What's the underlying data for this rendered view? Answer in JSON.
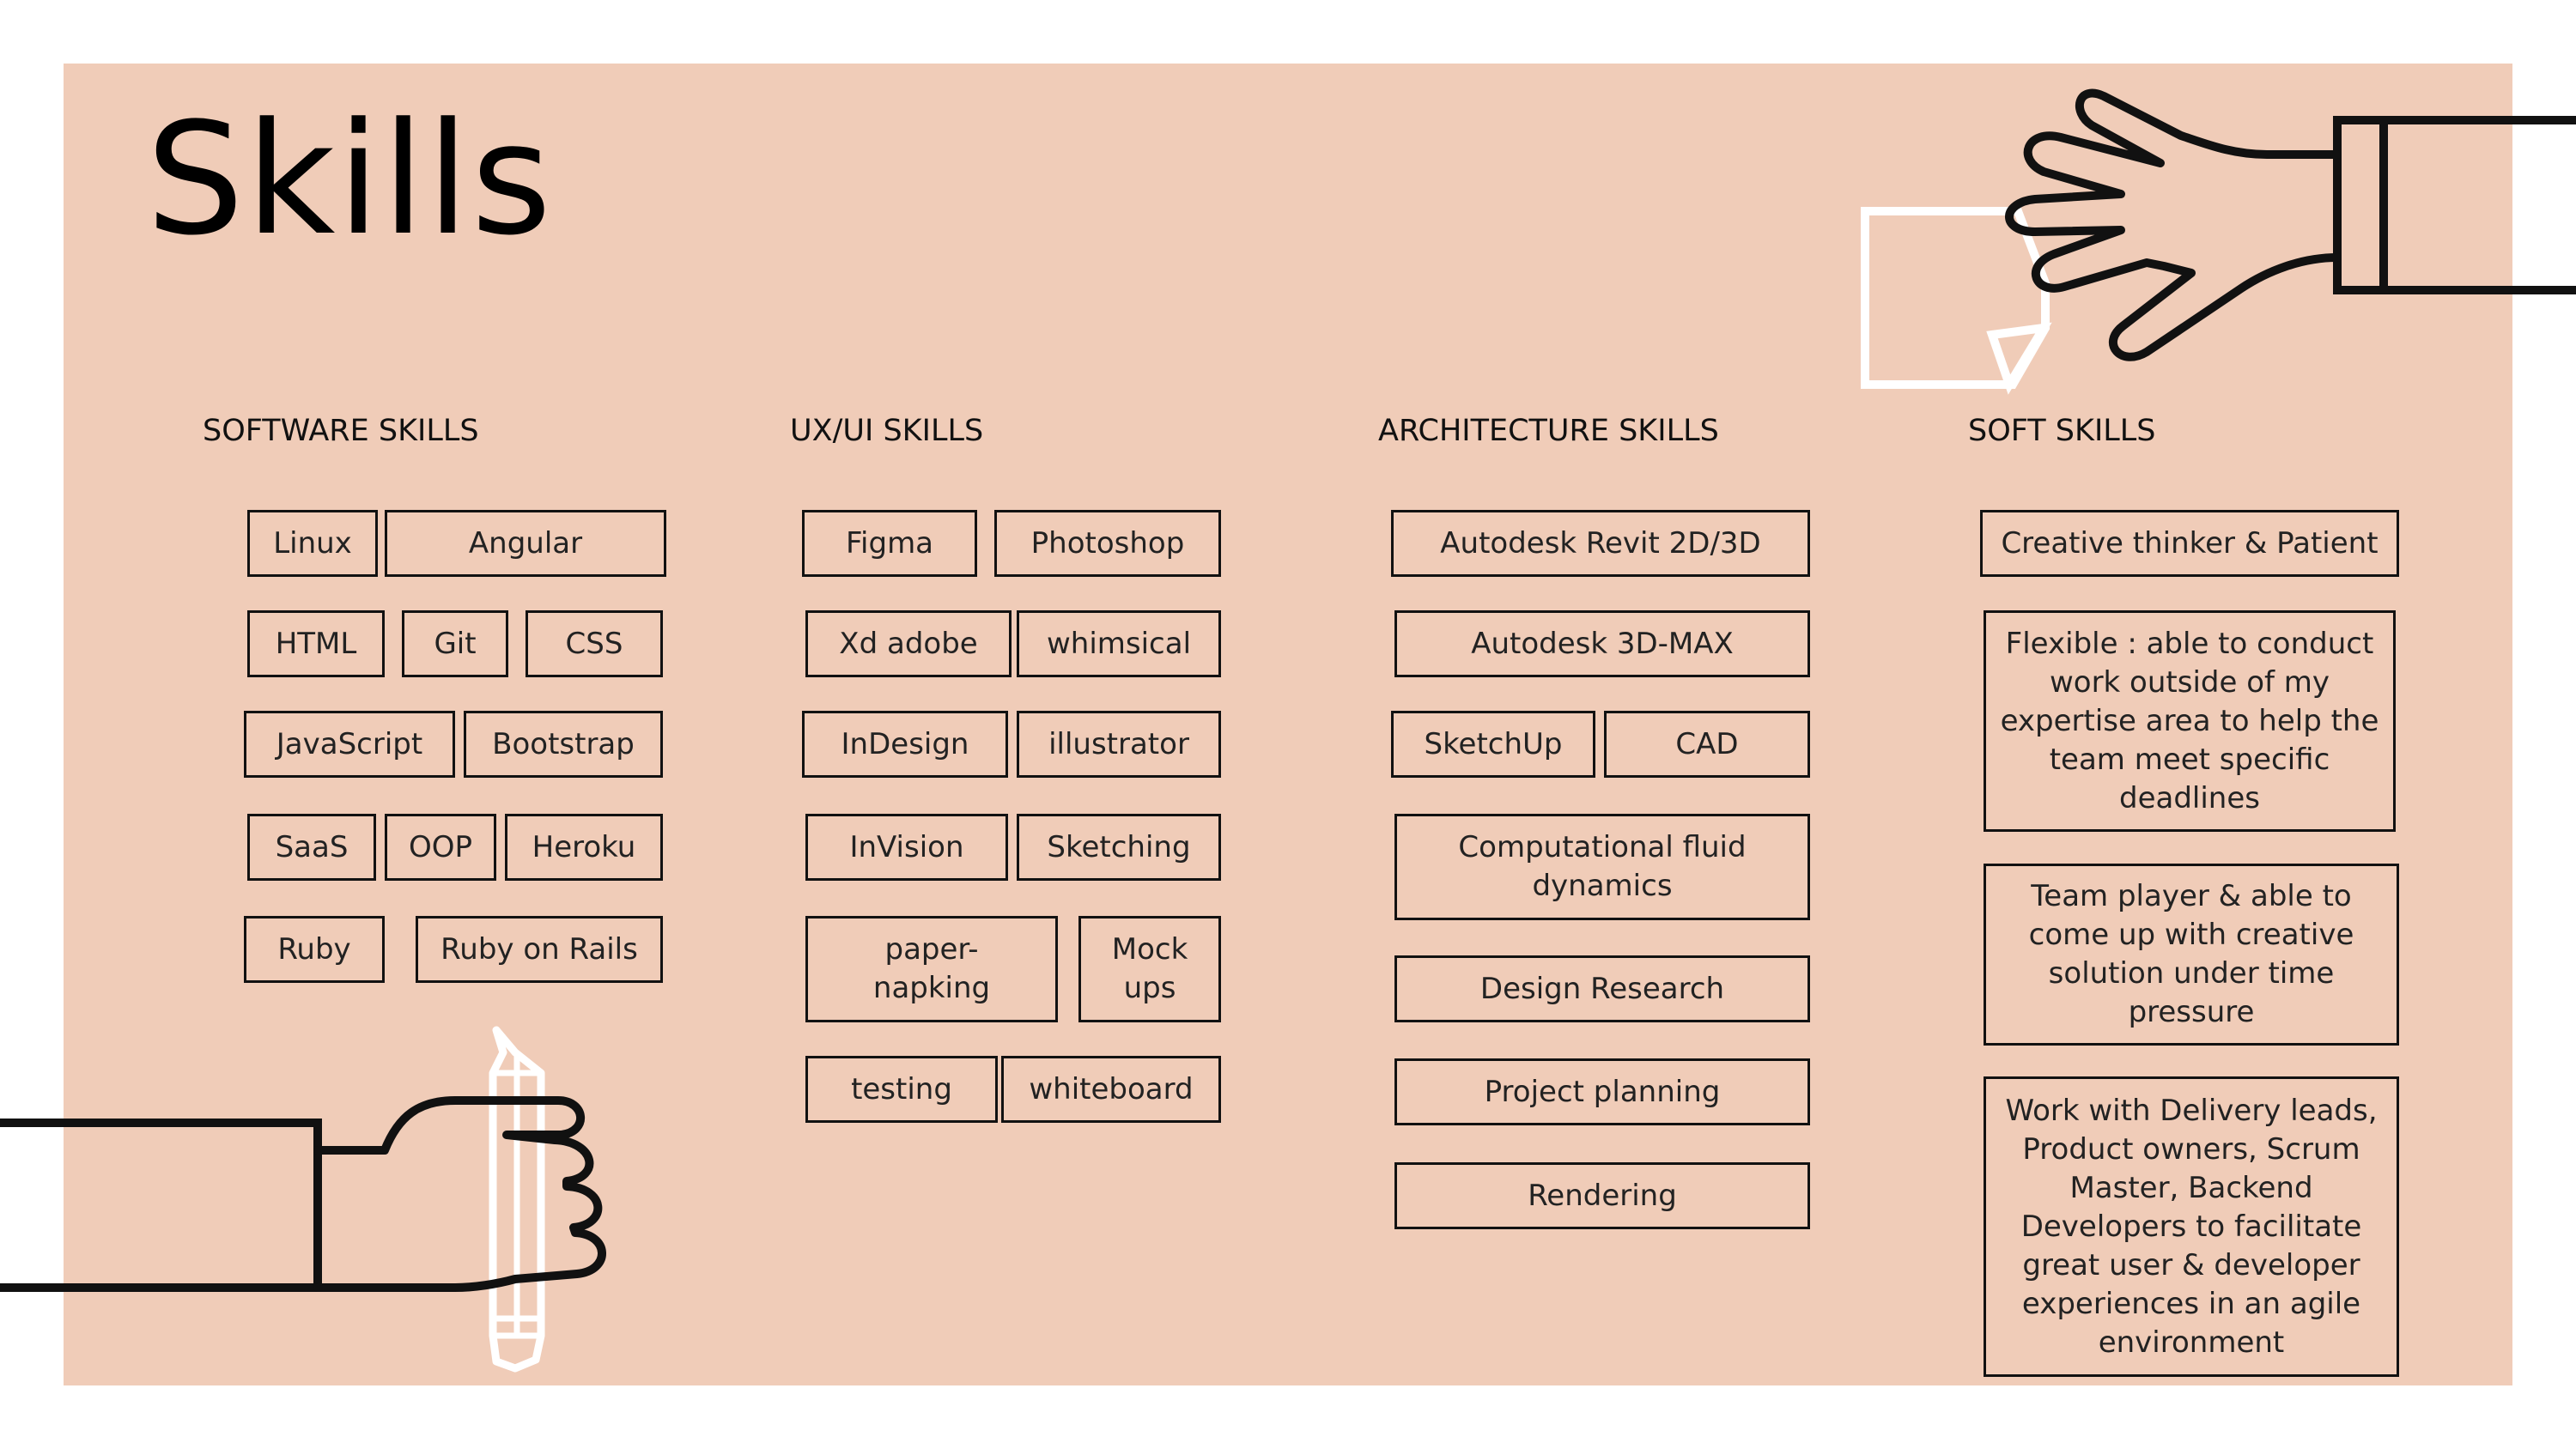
{
  "title": "Skills",
  "colors": {
    "background": "#f0ccb8",
    "ink": "#111111",
    "paper": "#ffffff"
  },
  "icons": [
    "hand-holding-pencil-icon",
    "hand-with-sticky-note-icon"
  ],
  "sections": {
    "software": {
      "heading": "SOFTWARE SKILLS",
      "items": [
        "Linux",
        "Angular",
        "HTML",
        "Git",
        "CSS",
        "JavaScript",
        "Bootstrap",
        "SaaS",
        "OOP",
        "Heroku",
        "Ruby",
        "Ruby on Rails"
      ]
    },
    "uxui": {
      "heading": "UX/UI SKILLS",
      "items": [
        "Figma",
        "Photoshop",
        "Xd adobe",
        "whimsical",
        "InDesign",
        "illustrator",
        "InVision",
        "Sketching",
        "paper-napking",
        "Mock ups",
        "testing",
        "whiteboard"
      ]
    },
    "architecture": {
      "heading": "ARCHITECTURE SKILLS",
      "items": [
        "Autodesk Revit 2D/3D",
        "Autodesk 3D-MAX",
        "SketchUp",
        "CAD",
        "Computational fluid dynamics",
        "Design Research",
        "Project planning",
        "Rendering"
      ]
    },
    "soft": {
      "heading": "SOFT SKILLS",
      "items": [
        "Creative thinker & Patient",
        "Flexible : able to conduct work outside of my expertise area  to help the team meet specific deadlines",
        "Team player & able to come up with creative solution under time pressure",
        "Work with  Delivery leads, Product owners, Scrum Master, Backend Developers to facilitate great user & developer experiences in an agile environment"
      ]
    }
  }
}
